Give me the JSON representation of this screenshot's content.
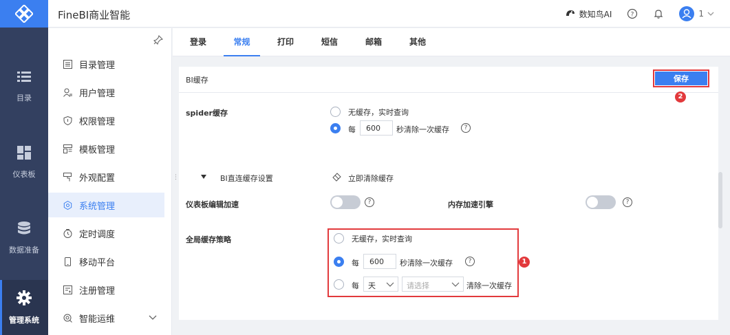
{
  "app": {
    "title": "FineBI商业智能"
  },
  "header": {
    "brand": "数知鸟AI",
    "user": "1"
  },
  "leftnav": [
    {
      "label": "目录",
      "icon": "list-icon"
    },
    {
      "label": "仪表板",
      "icon": "dashboard-icon"
    },
    {
      "label": "数据准备",
      "icon": "database-icon"
    },
    {
      "label": "管理系统",
      "icon": "gear-icon"
    }
  ],
  "sidebar": [
    {
      "label": "目录管理"
    },
    {
      "label": "用户管理"
    },
    {
      "label": "权限管理"
    },
    {
      "label": "模板管理"
    },
    {
      "label": "外观配置"
    },
    {
      "label": "系统管理"
    },
    {
      "label": "定时调度"
    },
    {
      "label": "移动平台"
    },
    {
      "label": "注册管理"
    },
    {
      "label": "智能运维"
    }
  ],
  "tabs": [
    {
      "label": "登录"
    },
    {
      "label": "常规"
    },
    {
      "label": "打印"
    },
    {
      "label": "短信"
    },
    {
      "label": "邮箱"
    },
    {
      "label": "其他"
    }
  ],
  "panel": {
    "title": "BI缓存",
    "save_label": "保存",
    "badge_save": "2",
    "badge_policy": "1",
    "spider_label": "spider缓存",
    "spider_opt1": "无缓存，实时查询",
    "spider_every": "每",
    "spider_seconds": "600",
    "spider_suffix": "秒清除一次缓存",
    "direct_label": "BI直连缓存设置",
    "clear_now": "立即清除缓存",
    "dash_accel": "仪表板编辑加速",
    "mem_accel": "内存加速引擎",
    "policy_label": "全局缓存策略",
    "policy_opt1": "无缓存，实时查询",
    "policy_every": "每",
    "policy_seconds": "600",
    "policy_suffix": "秒清除一次缓存",
    "policy_every2": "每",
    "policy_unit": "天",
    "policy_placeholder": "请选择",
    "policy_suffix2": "清除一次缓存"
  }
}
